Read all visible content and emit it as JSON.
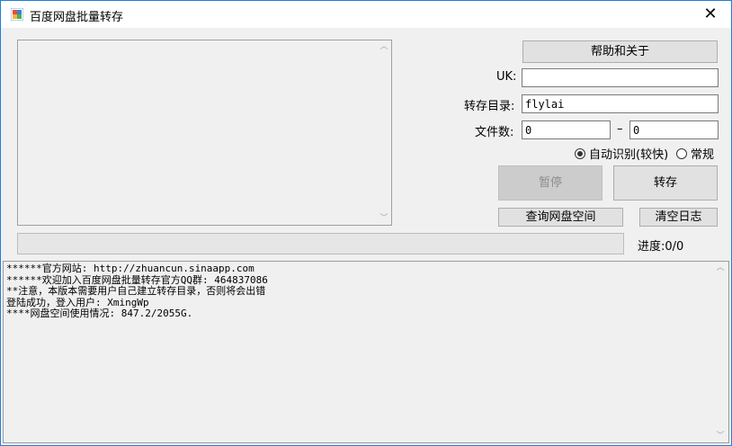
{
  "window": {
    "title": "百度网盘批量转存",
    "close_glyph": "✕"
  },
  "buttons": {
    "help": "帮助和关于",
    "pause": "暂停",
    "transfer": "转存",
    "query_space": "查询网盘空间",
    "clear_log": "清空日志"
  },
  "form": {
    "uk_label": "UK:",
    "uk_value": "",
    "dir_label": "转存目录:",
    "dir_value": "flylai",
    "count_label": "文件数:",
    "count_from": "0",
    "count_sep": "–",
    "count_to": "0",
    "radio_auto": "自动识别(较快)",
    "radio_normal": "常规",
    "radio_selected": "auto"
  },
  "progress": {
    "label": "进度:0/0",
    "fraction": 0
  },
  "log": {
    "lines": [
      "******官方网站: http://zhuancun.sinaapp.com",
      "******欢迎加入百度网盘批量转存官方QQ群: 464837086",
      "**注意，本版本需要用户自己建立转存目录，否则将会出错",
      "登陆成功，登入用户: XmingWp",
      "****网盘空间使用情况: 847.2/2055G."
    ]
  }
}
